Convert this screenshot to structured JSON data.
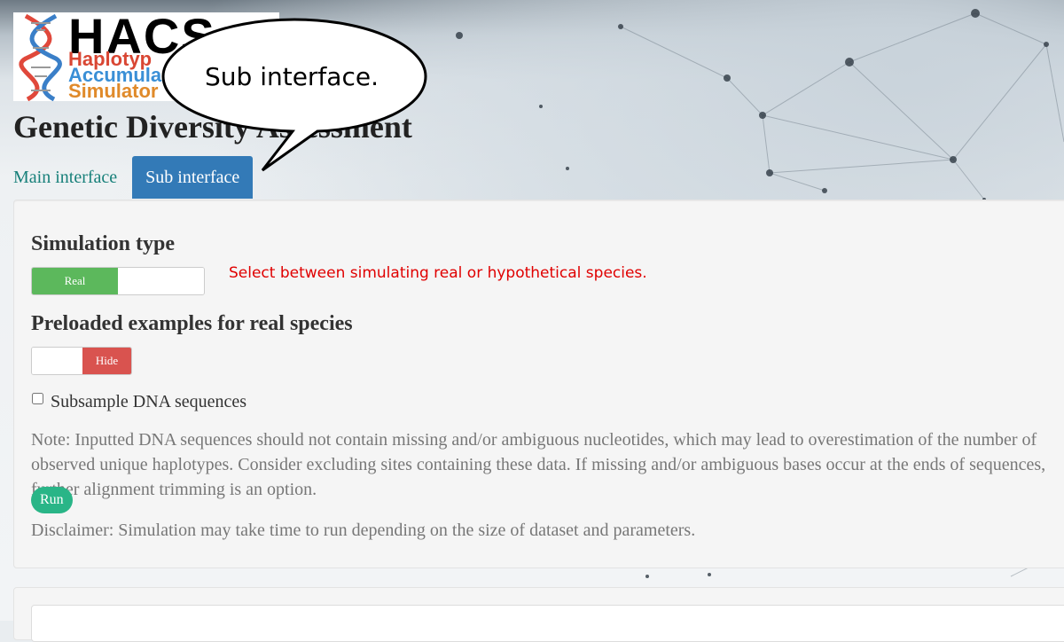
{
  "logo": {
    "acronym": "HACS",
    "line1": "Haplotyp",
    "line2": "Accumula",
    "line3": "Simulator"
  },
  "page_title": "Genetic Diversity Assessment",
  "tabs": [
    {
      "label": "Main interface",
      "active": false
    },
    {
      "label": "Sub interface",
      "active": true
    }
  ],
  "simulation": {
    "title": "Simulation type",
    "switch_on_label": "Real",
    "callout": "Select between simulating real or hypothetical species."
  },
  "preloaded": {
    "title": "Preloaded examples for real species",
    "switch_label": "Hide"
  },
  "subsample": {
    "label": "Subsample DNA sequences",
    "checked": false
  },
  "note": "Note: Inputted DNA sequences should not contain missing and/or ambiguous nucleotides, which may lead to overestimation of the number of observed unique haplotypes. Consider excluding sites containing these data. If missing and/or ambiguous bases occur at the ends of sequences, further alignment trimming is an option.",
  "run_label": "Run",
  "disclaimer": "Disclaimer: Simulation may take time to run depending on the size of dataset and parameters.",
  "speech_bubble": "Sub interface.",
  "colors": {
    "tab_active": "#337ab7",
    "tab_link": "#18807a",
    "switch_on": "#5cb85c",
    "switch_red": "#d9534f",
    "run_button": "#29b587",
    "callout": "#e00000"
  }
}
